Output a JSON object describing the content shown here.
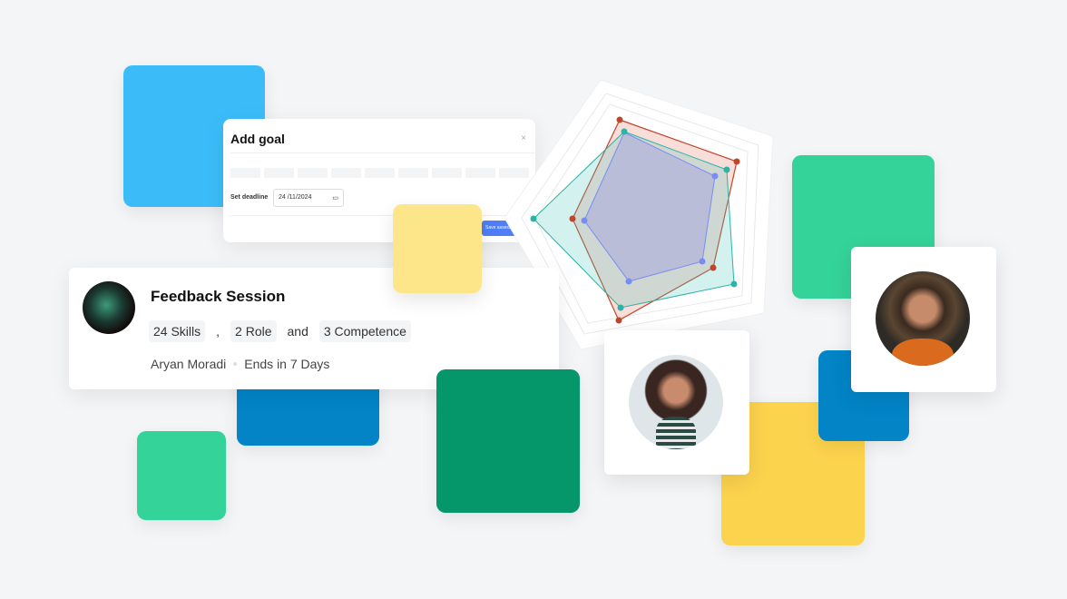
{
  "dialog": {
    "title": "Add goal",
    "close": "×",
    "deadline_label": "Set deadline",
    "deadline_value": "24 /11/2024",
    "calendar_icon": "calendar-icon",
    "submit_label": "Save assessment"
  },
  "feedback": {
    "title": "Feedback Session",
    "skills": "24 Skills",
    "comma": ",",
    "role": "2 Role",
    "and": "and",
    "competence": "3 Competence",
    "person": "Aryan Moradi",
    "ends": "Ends in 7 Days"
  },
  "colors": {
    "sky": "#3bbcf8",
    "green": "#34d399",
    "blue": "#0284c7",
    "darkgreen": "#059669",
    "yellow": "#fcd34d",
    "paleyellow": "#fde68a",
    "radar_red": "#c0462a",
    "radar_teal": "#2db3a5",
    "radar_blue": "#7b8cf0"
  }
}
